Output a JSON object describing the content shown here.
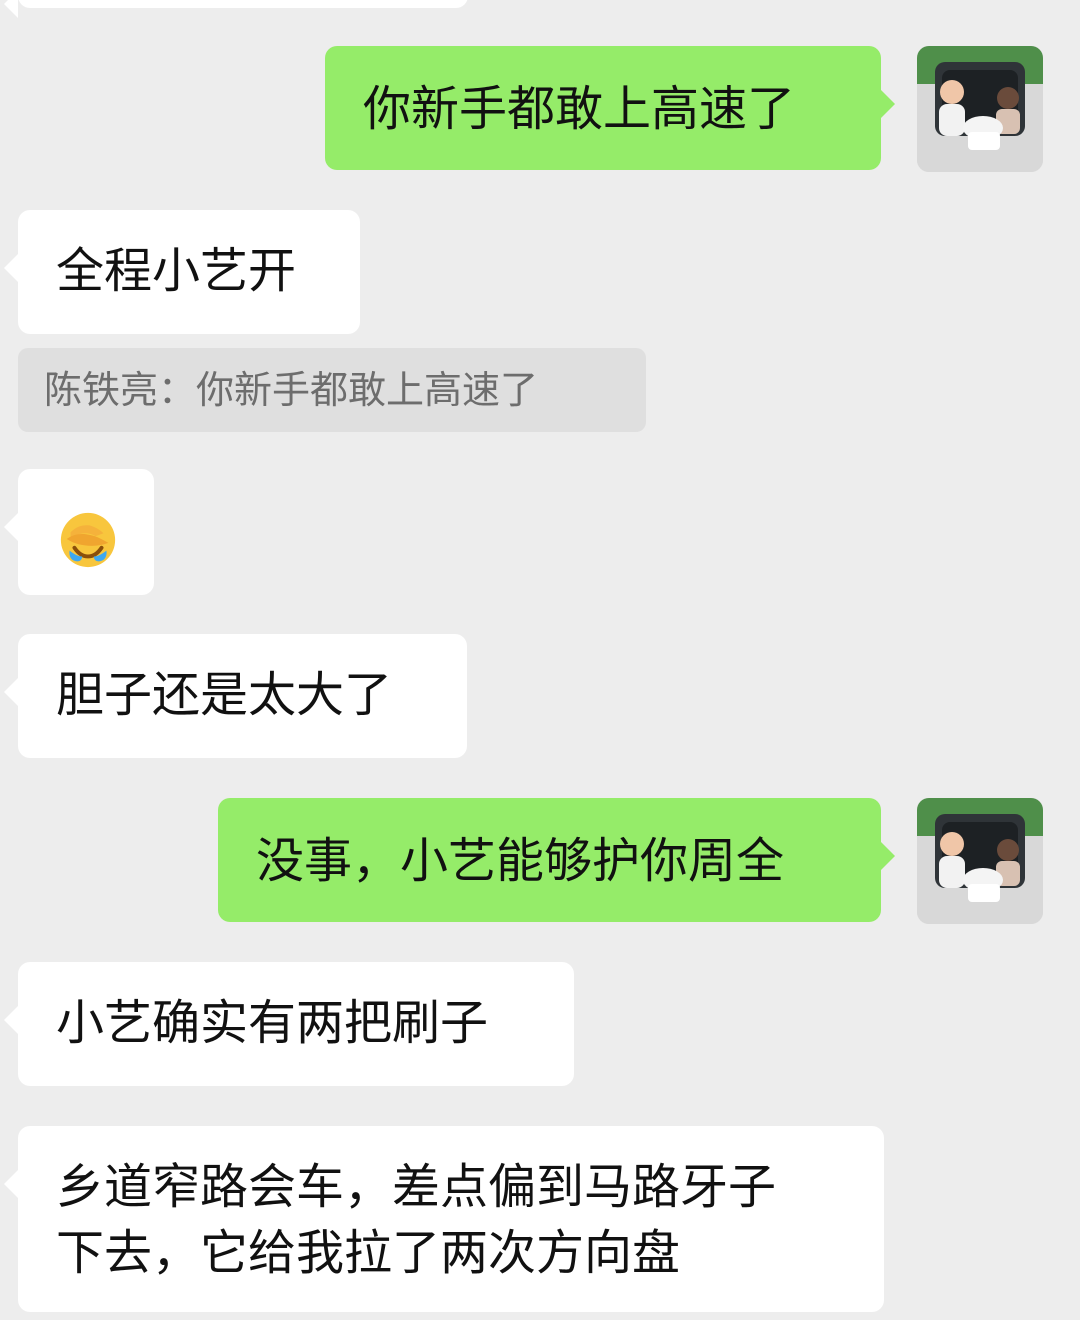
{
  "messages": [
    {
      "side": "right",
      "text": "你新手都敢上高速了"
    },
    {
      "side": "left",
      "text": "全程小艺开"
    },
    {
      "side": "left",
      "text": "胆子还是太大了"
    },
    {
      "side": "right",
      "text": "没事，小艺能够护你周全"
    },
    {
      "side": "left",
      "text": "小艺确实有两把刷子"
    },
    {
      "side": "left",
      "lines": [
        "乡道窄路会车，差点偏到马路牙子",
        "下去，它给我拉了两次方向盘"
      ]
    }
  ],
  "quote": {
    "text": "陈铁亮：你新手都敢上高速了"
  },
  "emoji": {
    "icon": "face-palm-crying-emoji"
  },
  "colors": {
    "background": "#ededed",
    "bubble_left": "#ffffff",
    "bubble_right": "#95ec69",
    "quote_bg": "#dfdfdf",
    "quote_text": "#6d6d6d"
  }
}
